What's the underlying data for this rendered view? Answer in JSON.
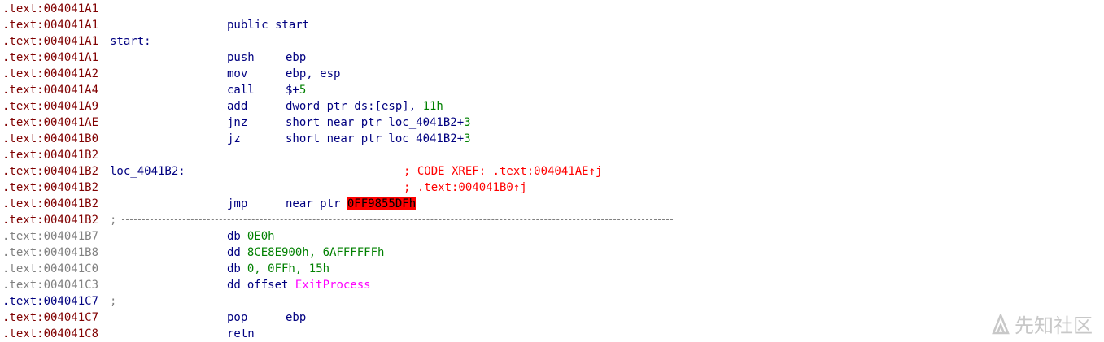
{
  "lines": [
    {
      "addr": ".text:004041A1",
      "kind": "code"
    },
    {
      "addr": ".text:004041A1",
      "kind": "code",
      "directive": "public start"
    },
    {
      "addr": ".text:004041A1",
      "kind": "code",
      "label": "start:"
    },
    {
      "addr": ".text:004041A1",
      "kind": "code",
      "mnemonic": "push",
      "operand": "ebp"
    },
    {
      "addr": ".text:004041A2",
      "kind": "code",
      "mnemonic": "mov",
      "operand": "ebp, esp"
    },
    {
      "addr": ".text:004041A4",
      "kind": "code",
      "mnemonic": "call",
      "operand": "$+",
      "num": "5"
    },
    {
      "addr": ".text:004041A9",
      "kind": "code",
      "mnemonic": "add",
      "operand": "dword ptr ds:[esp], ",
      "num": "11h"
    },
    {
      "addr": ".text:004041AE",
      "kind": "code",
      "mnemonic": "jnz",
      "operand": "short near ptr loc_4041B2+",
      "num": "3"
    },
    {
      "addr": ".text:004041B0",
      "kind": "code",
      "mnemonic": "jz",
      "operand": "short near ptr loc_4041B2+",
      "num": "3"
    },
    {
      "addr": ".text:004041B2",
      "kind": "code"
    },
    {
      "addr": ".text:004041B2",
      "kind": "code",
      "label": "loc_4041B2:",
      "comment": "; CODE XREF: .text:004041AE↑j"
    },
    {
      "addr": ".text:004041B2",
      "kind": "code",
      "comment": "; .text:004041B0↑j"
    },
    {
      "addr": ".text:004041B2",
      "kind": "code",
      "mnemonic": "jmp",
      "operand": "near ptr ",
      "highlight": "0FF9855DFh"
    },
    {
      "addr": ".text:004041B2",
      "kind": "code",
      "separator": ";"
    },
    {
      "addr": ".text:004041B7",
      "kind": "data",
      "mnemonic": "db",
      "tight": true,
      "num": "0E0h"
    },
    {
      "addr": ".text:004041B8",
      "kind": "data",
      "mnemonic": "dd",
      "tight": true,
      "num": "8CE8E900h, 6AFFFFFFh"
    },
    {
      "addr": ".text:004041C0",
      "kind": "data",
      "mnemonic": "db",
      "tight": true,
      "num": "0, 0FFh, 15h"
    },
    {
      "addr": ".text:004041C3",
      "kind": "data",
      "mnemonic": "dd",
      "tight": true,
      "operand": "offset ",
      "import": "ExitProcess"
    },
    {
      "addr": ".text:004041C7",
      "kind": "sep",
      "separator": ";"
    },
    {
      "addr": ".text:004041C7",
      "kind": "code",
      "mnemonic": "pop",
      "operand": "ebp"
    },
    {
      "addr": ".text:004041C8",
      "kind": "code",
      "mnemonic": "retn"
    }
  ],
  "watermark": {
    "text": "先知社区",
    "icon": "xianzhi-logo-icon"
  }
}
